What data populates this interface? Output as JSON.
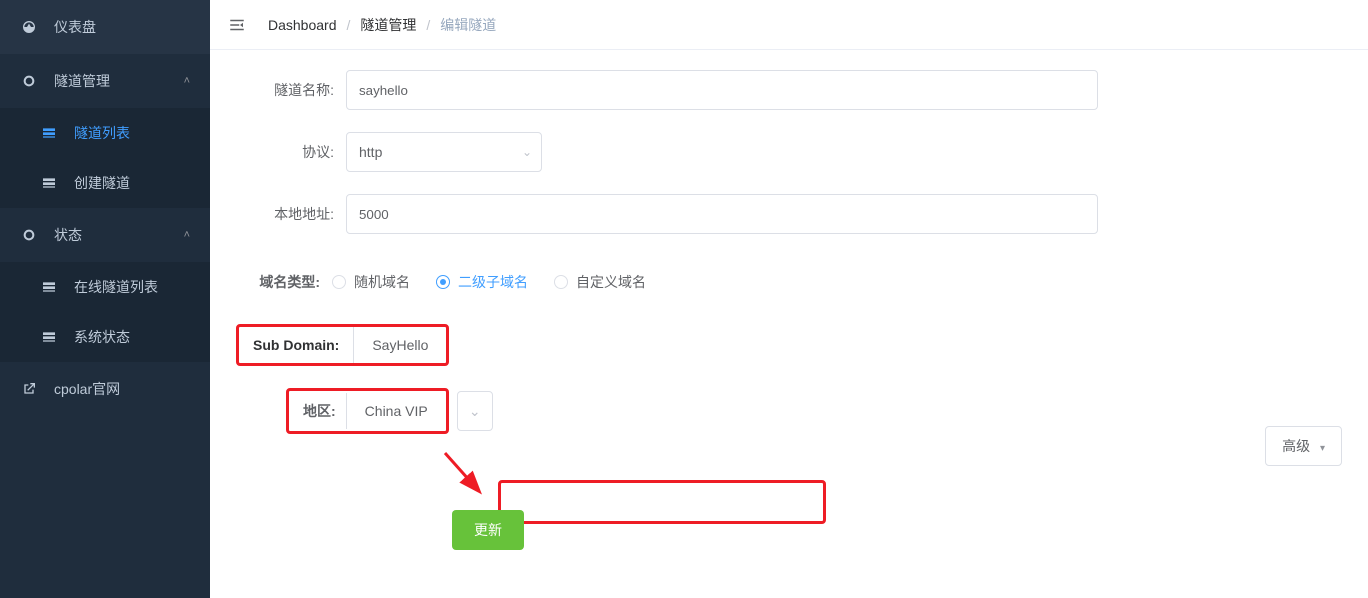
{
  "sidebar": {
    "items": [
      {
        "label": "仪表盘"
      },
      {
        "label": "隧道管理"
      },
      {
        "label": "隧道列表"
      },
      {
        "label": "创建隧道"
      },
      {
        "label": "状态"
      },
      {
        "label": "在线隧道列表"
      },
      {
        "label": "系统状态"
      },
      {
        "label": "cpolar官网"
      }
    ]
  },
  "breadcrumbs": {
    "a": "Dashboard",
    "b": "隧道管理",
    "c": "编辑隧道"
  },
  "form": {
    "tunnel_name_label": "隧道名称:",
    "tunnel_name_value": "sayhello",
    "protocol_label": "协议:",
    "protocol_value": "http",
    "local_addr_label": "本地地址:",
    "local_addr_value": "5000",
    "domain_type_label": "域名类型:",
    "domain_type_options": {
      "random": "随机域名",
      "sub": "二级子域名",
      "custom": "自定义域名"
    },
    "sub_domain_label": "Sub Domain:",
    "sub_domain_value": "SayHello",
    "region_label": "地区:",
    "region_value": "China VIP"
  },
  "buttons": {
    "advanced": "高级",
    "update": "更新"
  }
}
